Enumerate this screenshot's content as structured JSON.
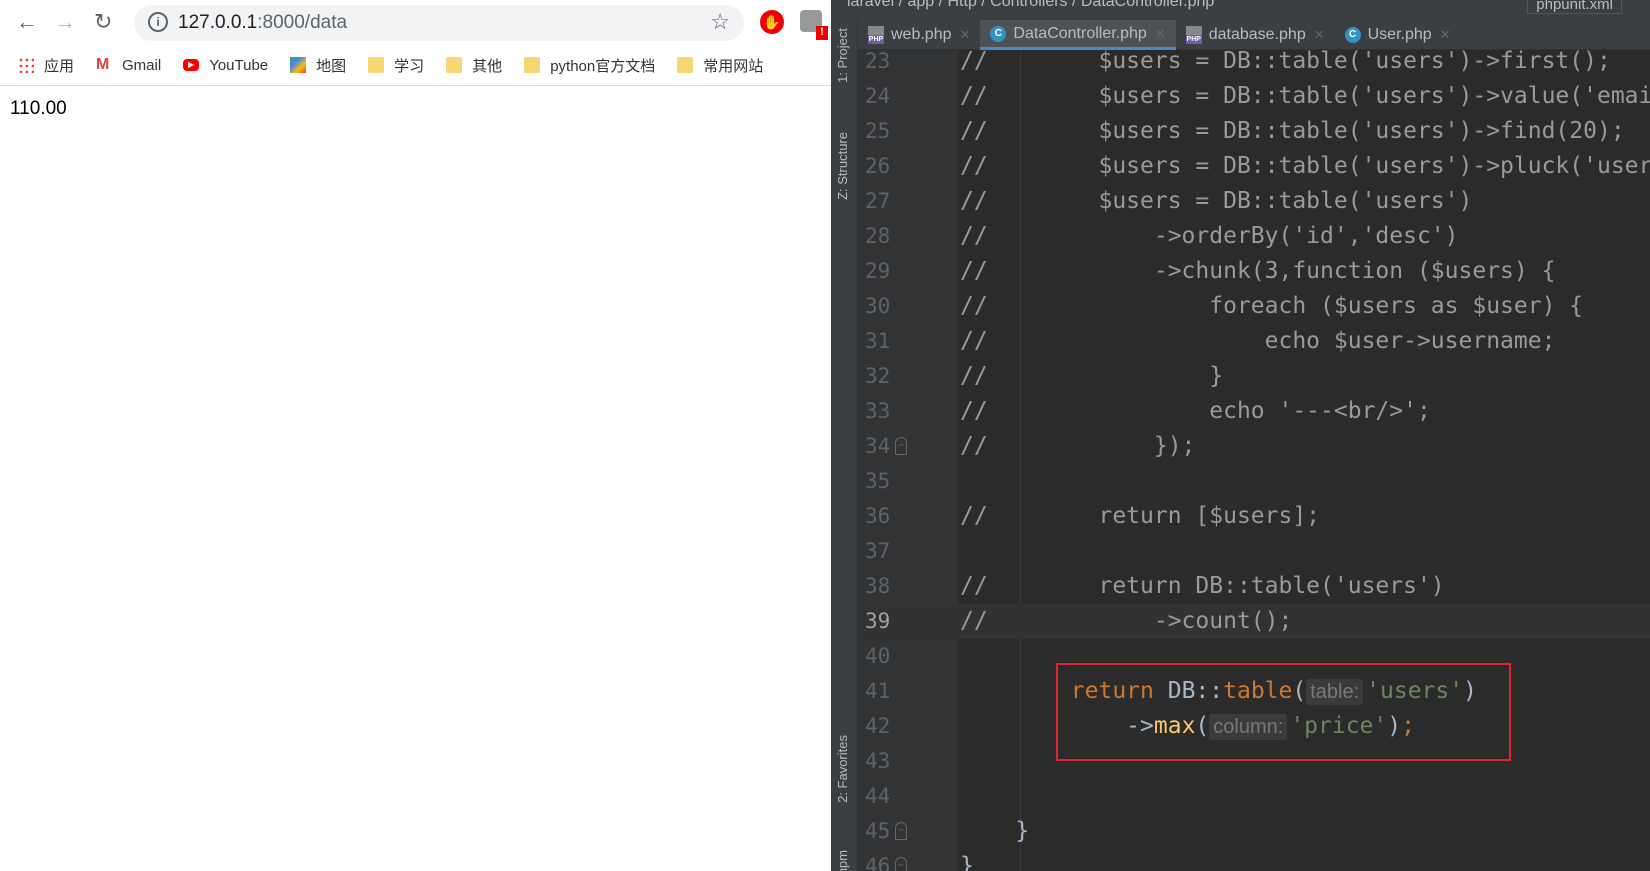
{
  "browser": {
    "url_host": "127.0.0.1",
    "url_rest": ":8000/data",
    "bookmarks": [
      {
        "label": "应用",
        "icon": "apps-grid-icon"
      },
      {
        "label": "Gmail",
        "icon": "gmail-icon"
      },
      {
        "label": "YouTube",
        "icon": "youtube-icon"
      },
      {
        "label": "地图",
        "icon": "maps-icon"
      },
      {
        "label": "学习",
        "icon": "folder-icon"
      },
      {
        "label": "其他",
        "icon": "folder-icon"
      },
      {
        "label": "python官方文档",
        "icon": "folder-icon"
      },
      {
        "label": "常用网站",
        "icon": "folder-icon"
      }
    ],
    "page_output": "110.00",
    "ext_badge": "!"
  },
  "ide": {
    "breadcrumb": "laravel / app / Http / Controllers / DataController.php",
    "run_config": "phpunit.xml",
    "toolwindows": {
      "project": "1: Project",
      "structure": "Z: Structure",
      "favorites": "2: Favorites",
      "npm": "npm"
    },
    "tabs": [
      {
        "label": "web.php",
        "icon": "php-file-icon"
      },
      {
        "label": "DataController.php",
        "icon": "class-icon",
        "active": true
      },
      {
        "label": "database.php",
        "icon": "php-file-icon"
      },
      {
        "label": "User.php",
        "icon": "class-icon"
      }
    ],
    "lines": [
      {
        "num": "23",
        "text": "//        $users = DB::table('users')->first();"
      },
      {
        "num": "24",
        "text": "//        $users = DB::table('users')->value('email');"
      },
      {
        "num": "25",
        "text": "//        $users = DB::table('users')->find(20);"
      },
      {
        "num": "26",
        "text": "//        $users = DB::table('users')->pluck('username');"
      },
      {
        "num": "27",
        "text": "//        $users = DB::table('users')"
      },
      {
        "num": "28",
        "text": "//            ->orderBy('id','desc')"
      },
      {
        "num": "29",
        "text": "//            ->chunk(3,function ($users) {"
      },
      {
        "num": "30",
        "text": "//                foreach ($users as $user) {"
      },
      {
        "num": "31",
        "text": "//                    echo $user->username;"
      },
      {
        "num": "32",
        "text": "//                }"
      },
      {
        "num": "33",
        "text": "//                echo '---<br/>';"
      },
      {
        "num": "34",
        "text": "//            });"
      },
      {
        "num": "35",
        "text": ""
      },
      {
        "num": "36",
        "text": "//        return [$users];"
      },
      {
        "num": "37",
        "text": ""
      },
      {
        "num": "38",
        "text": "//        return DB::table('users')"
      },
      {
        "num": "39",
        "text": "//            ->count();"
      },
      {
        "num": "40",
        "text": ""
      }
    ],
    "l41": {
      "num": "41",
      "kw": "return",
      "cls": " DB::",
      "fn": "table",
      "open": "(",
      "hint": "table:",
      "arg": "'users'",
      "close": ")"
    },
    "l42": {
      "num": "42",
      "arrow": "->",
      "fn": "max",
      "open": "(",
      "hint": "column:",
      "arg": "'price'",
      "close": ")",
      "semi": ";"
    },
    "tail": [
      {
        "num": "43",
        "text": ""
      },
      {
        "num": "44",
        "text": ""
      },
      {
        "num": "45",
        "text": "    }"
      },
      {
        "num": "46",
        "text": "}"
      }
    ]
  }
}
